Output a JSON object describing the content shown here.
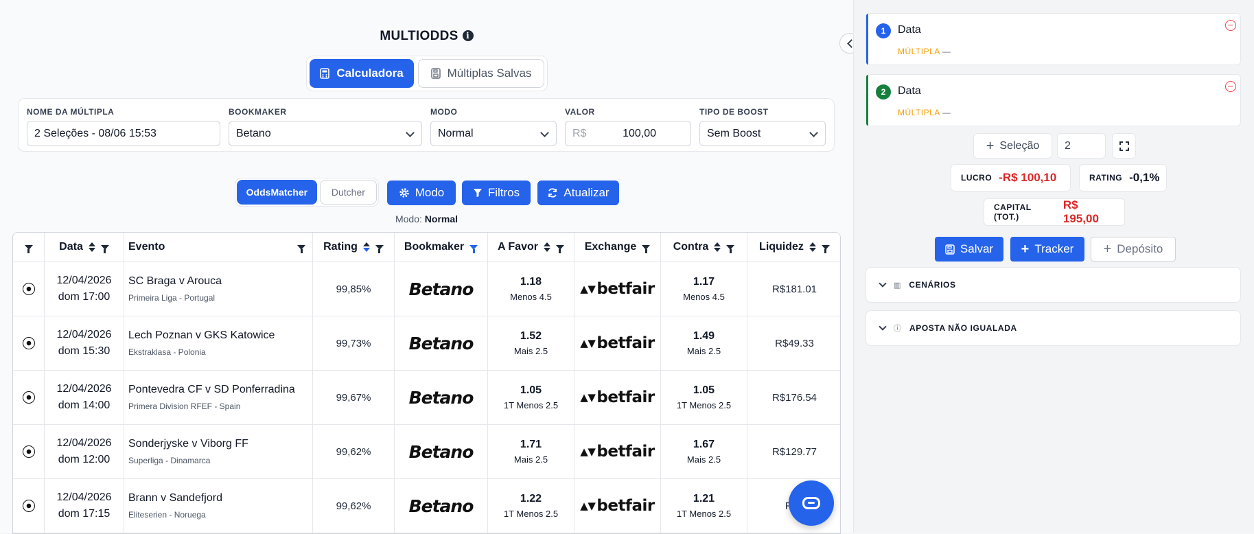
{
  "app": {
    "title": "MULTIODDS"
  },
  "tabs": [
    {
      "label": "Calculadora",
      "icon": "calculator-icon"
    },
    {
      "label": "Múltiplas Salvas",
      "icon": "save-icon"
    }
  ],
  "form": {
    "name_label": "NOME DA MÚLTIPLA",
    "name_value": "2 Seleções - 08/06 15:53",
    "bookmaker_label": "BOOKMAKER",
    "bookmaker_value": "Betano",
    "mode_label": "MODO",
    "mode_value": "Normal",
    "value_label": "VALOR",
    "currency": "R$",
    "value_value": "100,00",
    "boost_label": "TIPO DE BOOST",
    "boost_value": "Sem Boost"
  },
  "toolbar": {
    "seg_on": "OddsMatcher",
    "seg_off": "Dutcher",
    "modo": "Modo",
    "filtros": "Filtros",
    "atualizar": "Atualizar",
    "modo_line_prefix": "Modo:",
    "modo_line_value": "Normal"
  },
  "table": {
    "headers": {
      "data": "Data",
      "evento": "Evento",
      "rating": "Rating",
      "bookmaker": "Bookmaker",
      "afavor": "A Favor",
      "exchange": "Exchange",
      "contra": "Contra",
      "liquidez": "Liquidez"
    },
    "rows": [
      {
        "date": "12/04/2026",
        "time": "dom 17:00",
        "event": "SC Braga v Arouca",
        "league": "Primeira Liga - Portugal",
        "rating": "99,85%",
        "book": "Betano",
        "back": "1.18",
        "back_mk": "Menos 4.5",
        "exch": "betfair",
        "lay": "1.17",
        "lay_mk": "Menos 4.5",
        "liq": "R$181.01"
      },
      {
        "date": "12/04/2026",
        "time": "dom 15:30",
        "event": "Lech Poznan v GKS Katowice",
        "league": "Ekstraklasa - Polonia",
        "rating": "99,73%",
        "book": "Betano",
        "back": "1.52",
        "back_mk": "Mais 2.5",
        "exch": "betfair",
        "lay": "1.49",
        "lay_mk": "Mais 2.5",
        "liq": "R$49.33"
      },
      {
        "date": "12/04/2026",
        "time": "dom 14:00",
        "event": "Pontevedra CF v SD Ponferradina",
        "league": "Primera Division RFEF - Spain",
        "rating": "99,67%",
        "book": "Betano",
        "back": "1.05",
        "back_mk": "1T Menos 2.5",
        "exch": "betfair",
        "lay": "1.05",
        "lay_mk": "1T Menos 2.5",
        "liq": "R$176.54"
      },
      {
        "date": "12/04/2026",
        "time": "dom 12:00",
        "event": "Sonderjyske v Viborg FF",
        "league": "Superliga - Dinamarca",
        "rating": "99,62%",
        "book": "Betano",
        "back": "1.71",
        "back_mk": "Mais 2.5",
        "exch": "betfair",
        "lay": "1.67",
        "lay_mk": "Mais 2.5",
        "liq": "R$129.77"
      },
      {
        "date": "12/04/2026",
        "time": "dom 17:15",
        "event": "Brann v Sandefjord",
        "league": "Eliteserien - Noruega",
        "rating": "99,62%",
        "book": "Betano",
        "back": "1.22",
        "back_mk": "1T Menos 2.5",
        "exch": "betfair",
        "lay": "1.21",
        "lay_mk": "1T Menos 2.5",
        "liq": "R$2"
      }
    ]
  },
  "sidebar": {
    "selections": [
      {
        "num": "1",
        "name": "Data",
        "mult": "MÚLTIPLA",
        "dash": "—",
        "color": "#2563eb"
      },
      {
        "num": "2",
        "name": "Data",
        "mult": "MÚLTIPLA",
        "dash": "—",
        "color": "#15803d"
      }
    ],
    "add_selection": "Seleção",
    "count": "2",
    "lucro_label": "LUCRO",
    "lucro_value": "-R$ 100,10",
    "rating_label": "RATING",
    "rating_value": "-0,1%",
    "capital_label": "CAPITAL (TOT.)",
    "capital_value": "R$ 195,00",
    "salvar": "Salvar",
    "tracker": "Tracker",
    "deposito": "Depósito",
    "cenarios": "CENÁRIOS",
    "aposta": "APOSTA NÃO IGUALADA"
  },
  "colors": {
    "accent": "#2563eb",
    "negative": "#dc2626",
    "warning": "#f59e0b"
  }
}
